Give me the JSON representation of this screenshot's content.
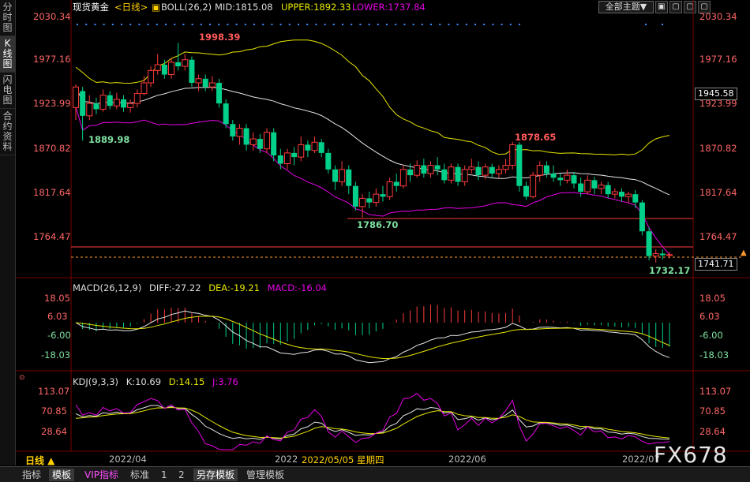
{
  "sidebar": {
    "tabs": [
      {
        "label": "分时图",
        "active": false
      },
      {
        "label": "K线图",
        "active": true
      },
      {
        "label": "闪电图",
        "active": false
      },
      {
        "label": "合约资料",
        "active": false
      }
    ]
  },
  "header": {
    "instrument": "现货黄金",
    "period": "<日线>",
    "boll": "BOLL(26,2)",
    "mid": "MID:1815.08",
    "upper": "UPPER:1892.33",
    "lower": "LOWER:1737.84",
    "theme_button": "全部主题▼",
    "window_buttons": [
      "▣",
      "▢",
      "▢",
      "▢"
    ]
  },
  "main": {
    "ticks": [
      "2030.34",
      "1977.16",
      "1923.99",
      "1870.82",
      "1817.64",
      "1764.47"
    ],
    "current_price": "1945.58",
    "last_price": "1741.71",
    "marks": {
      "high": "1998.39",
      "low1": "1889.98",
      "peak2": "1878.65",
      "low2": "1786.70",
      "low3": "1732.17"
    },
    "colors": {
      "up": "#ff3b3b",
      "down": "#00d08a",
      "mid": "#e6e6e6",
      "upper": "#e6e600",
      "lower": "#e600e6",
      "hline": "#ff3b3b"
    }
  },
  "macd": {
    "title": "MACD(26,12,9)",
    "diff": "DIFF:-27.22",
    "dea": "DEA:-19.21",
    "macd": "MACD:-16.04",
    "ticks": [
      "18.05",
      "6.03",
      "-6.00",
      "-18.03"
    ]
  },
  "kdj": {
    "title": "KDJ(9,3,3)",
    "k": "K:10.69",
    "d": "D:14.15",
    "j": "J:3.76",
    "ticks": [
      "113.07",
      "70.85",
      "28.64"
    ]
  },
  "bottom": {
    "period": "日线 ▲",
    "dates": [
      "2022/04",
      "2022",
      "2022/05/05 星期四",
      "2022/06",
      "2022/07"
    ]
  },
  "tabs": [
    "指标",
    "模板",
    "VIP指标",
    "标准",
    "1",
    "2",
    "另存模板",
    "管理模板"
  ],
  "watermark": "FX678",
  "chart_data": {
    "type": "candlestick",
    "title": "现货黄金 <日线>",
    "main_ylim": [
      1732,
      2030.34
    ],
    "indicators": {
      "BOLL": {
        "params": "26,2",
        "MID": 1815.08,
        "UPPER": 1892.33,
        "LOWER": 1737.84
      },
      "MACD": {
        "params": "26,12,9",
        "DIFF": -27.22,
        "DEA": -19.21,
        "MACD": -16.04
      },
      "KDJ": {
        "params": "9,3,3",
        "K": 10.69,
        "D": 14.15,
        "J": 3.76
      }
    },
    "annotations": [
      1998.39,
      1889.98,
      1878.65,
      1786.7,
      1732.17
    ],
    "candles": [
      [
        1920,
        1945,
        1948,
        1905
      ],
      [
        1940,
        1910,
        1945,
        1880
      ],
      [
        1910,
        1925,
        1935,
        1905
      ],
      [
        1925,
        1918,
        1932,
        1912
      ],
      [
        1918,
        1935,
        1942,
        1915
      ],
      [
        1935,
        1922,
        1940,
        1918
      ],
      [
        1922,
        1930,
        1938,
        1918
      ],
      [
        1930,
        1920,
        1935,
        1915
      ],
      [
        1920,
        1925,
        1930,
        1914
      ],
      [
        1925,
        1937,
        1942,
        1920
      ],
      [
        1937,
        1950,
        1958,
        1935
      ],
      [
        1950,
        1965,
        1970,
        1945
      ],
      [
        1965,
        1972,
        1985,
        1960
      ],
      [
        1972,
        1960,
        1978,
        1955
      ],
      [
        1960,
        1975,
        1980,
        1955
      ],
      [
        1975,
        1970,
        1998.39,
        1965
      ],
      [
        1970,
        1978,
        1985,
        1965
      ],
      [
        1978,
        1950,
        1982,
        1945
      ],
      [
        1950,
        1955,
        1960,
        1940
      ],
      [
        1955,
        1945,
        1960,
        1940
      ],
      [
        1945,
        1950,
        1958,
        1940
      ],
      [
        1950,
        1925,
        1955,
        1920
      ],
      [
        1925,
        1900,
        1930,
        1895
      ],
      [
        1900,
        1885,
        1905,
        1880
      ],
      [
        1885,
        1895,
        1900,
        1875
      ],
      [
        1895,
        1875,
        1900,
        1868
      ],
      [
        1875,
        1882,
        1890,
        1868
      ],
      [
        1882,
        1870,
        1888,
        1865
      ],
      [
        1870,
        1890,
        1895,
        1865
      ],
      [
        1890,
        1862,
        1895,
        1855
      ],
      [
        1862,
        1852,
        1870,
        1845
      ],
      [
        1852,
        1865,
        1870,
        1845
      ],
      [
        1865,
        1860,
        1872,
        1850
      ],
      [
        1860,
        1875,
        1885,
        1855
      ],
      [
        1875,
        1868,
        1880,
        1860
      ],
      [
        1868,
        1878,
        1885,
        1865
      ],
      [
        1878,
        1865,
        1882,
        1860
      ],
      [
        1865,
        1845,
        1870,
        1840
      ],
      [
        1845,
        1830,
        1850,
        1820
      ],
      [
        1830,
        1845,
        1855,
        1825
      ],
      [
        1845,
        1825,
        1850,
        1815
      ],
      [
        1825,
        1800,
        1830,
        1795
      ],
      [
        1800,
        1810,
        1815,
        1786.7
      ],
      [
        1810,
        1805,
        1818,
        1798
      ],
      [
        1805,
        1815,
        1822,
        1800
      ],
      [
        1815,
        1812,
        1825,
        1806
      ],
      [
        1812,
        1830,
        1835,
        1808
      ],
      [
        1830,
        1825,
        1840,
        1818
      ],
      [
        1825,
        1845,
        1850,
        1822
      ],
      [
        1845,
        1838,
        1852,
        1830
      ],
      [
        1838,
        1850,
        1856,
        1835
      ],
      [
        1850,
        1840,
        1858,
        1835
      ],
      [
        1840,
        1850,
        1855,
        1835
      ],
      [
        1850,
        1845,
        1860,
        1838
      ],
      [
        1845,
        1832,
        1852,
        1828
      ],
      [
        1832,
        1848,
        1852,
        1828
      ],
      [
        1848,
        1830,
        1852,
        1825
      ],
      [
        1830,
        1845,
        1850,
        1825
      ],
      [
        1845,
        1848,
        1858,
        1840
      ],
      [
        1848,
        1838,
        1855,
        1832
      ],
      [
        1838,
        1848,
        1852,
        1833
      ],
      [
        1848,
        1840,
        1852,
        1835
      ],
      [
        1840,
        1845,
        1850,
        1835
      ],
      [
        1845,
        1850,
        1858,
        1840
      ],
      [
        1850,
        1875,
        1878.65,
        1845
      ],
      [
        1875,
        1825,
        1878,
        1818
      ],
      [
        1825,
        1812,
        1830,
        1808
      ],
      [
        1812,
        1838,
        1842,
        1810
      ],
      [
        1838,
        1850,
        1855,
        1830
      ],
      [
        1850,
        1840,
        1855,
        1835
      ],
      [
        1840,
        1835,
        1850,
        1830
      ],
      [
        1835,
        1832,
        1840,
        1825
      ],
      [
        1832,
        1838,
        1845,
        1828
      ],
      [
        1838,
        1828,
        1842,
        1822
      ],
      [
        1828,
        1818,
        1835,
        1812
      ],
      [
        1818,
        1832,
        1838,
        1815
      ],
      [
        1832,
        1822,
        1836,
        1815
      ],
      [
        1822,
        1826,
        1830,
        1815
      ],
      [
        1826,
        1815,
        1830,
        1810
      ],
      [
        1815,
        1818,
        1822,
        1810
      ],
      [
        1818,
        1812,
        1822,
        1806
      ],
      [
        1812,
        1815,
        1818,
        1805
      ],
      [
        1815,
        1805,
        1820,
        1798
      ],
      [
        1805,
        1770,
        1808,
        1765
      ],
      [
        1770,
        1740,
        1775,
        1735
      ],
      [
        1740,
        1743,
        1748,
        1732.17
      ],
      [
        1743,
        1741,
        1748,
        1736
      ],
      [
        1741,
        1741.71,
        1745,
        1737
      ]
    ],
    "macd_ylim": [
      -30,
      24
    ],
    "kdj_ylim": [
      0,
      130
    ]
  }
}
